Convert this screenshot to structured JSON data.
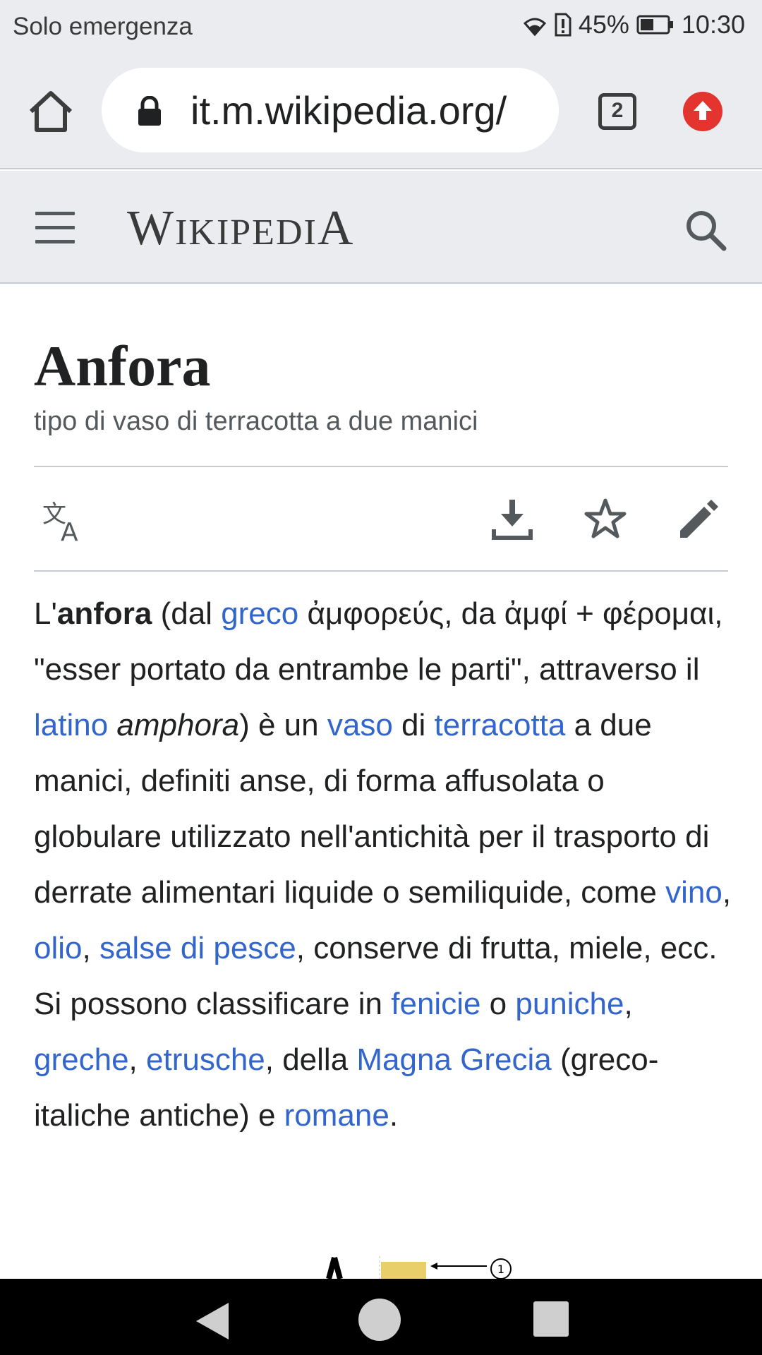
{
  "status_bar": {
    "carrier": "Solo emergenza",
    "battery_percent": "45%",
    "time": "10:30"
  },
  "browser": {
    "url": "it.m.wikipedia.org/",
    "tab_count": "2"
  },
  "wikipedia_header": {
    "wordmark_parts": [
      "W",
      "IKIPEDI",
      "A"
    ]
  },
  "article": {
    "title": "Anfora",
    "subtitle": "tipo di vaso di terracotta a due manici",
    "paragraph": [
      {
        "t": "L'"
      },
      {
        "t": "anfora",
        "style": "bold"
      },
      {
        "t": " (dal "
      },
      {
        "t": "greco",
        "link": true
      },
      {
        "t": " ἀμφορεύς, da ἀμφί + φέρομαι, \"esser portato da entrambe le parti\", attraverso il "
      },
      {
        "t": "latino",
        "link": true
      },
      {
        "t": " "
      },
      {
        "t": "amphora",
        "style": "italic"
      },
      {
        "t": ") è un "
      },
      {
        "t": "vaso",
        "link": true
      },
      {
        "t": " di "
      },
      {
        "t": "terracotta",
        "link": true
      },
      {
        "t": " a due manici, definiti anse, di forma affusolata o globulare utilizzato nell'antichità per il trasporto di derrate alimentari liquide o semiliquide, come "
      },
      {
        "t": "vino",
        "link": true
      },
      {
        "t": ", "
      },
      {
        "t": "olio",
        "link": true
      },
      {
        "t": ", "
      },
      {
        "t": "salse di pesce",
        "link": true
      },
      {
        "t": ", conserve di frutta, miele, ecc. Si possono classificare in "
      },
      {
        "t": "fenicie",
        "link": true
      },
      {
        "t": " o "
      },
      {
        "t": "puniche",
        "link": true
      },
      {
        "t": ", "
      },
      {
        "t": "greche",
        "link": true
      },
      {
        "t": ", "
      },
      {
        "t": "etrusche",
        "link": true
      },
      {
        "t": ", della "
      },
      {
        "t": "Magna Grecia",
        "link": true
      },
      {
        "t": " (greco-italiche antiche) e "
      },
      {
        "t": "romane",
        "link": true
      },
      {
        "t": "."
      }
    ]
  },
  "figure_marker": "1",
  "colors": {
    "link": "#3366cc",
    "chrome_bg": "#eaecf0",
    "update_badge": "#e3342f"
  },
  "icons": {
    "toolbar": [
      "home-icon",
      "lock-icon",
      "tab-switcher-icon",
      "update-icon"
    ],
    "wiki_header": [
      "menu-icon",
      "search-icon"
    ],
    "page_actions": [
      "language-icon",
      "download-icon",
      "star-icon",
      "edit-icon"
    ],
    "navbar": [
      "back-icon",
      "home-circle-icon",
      "recents-icon"
    ]
  }
}
